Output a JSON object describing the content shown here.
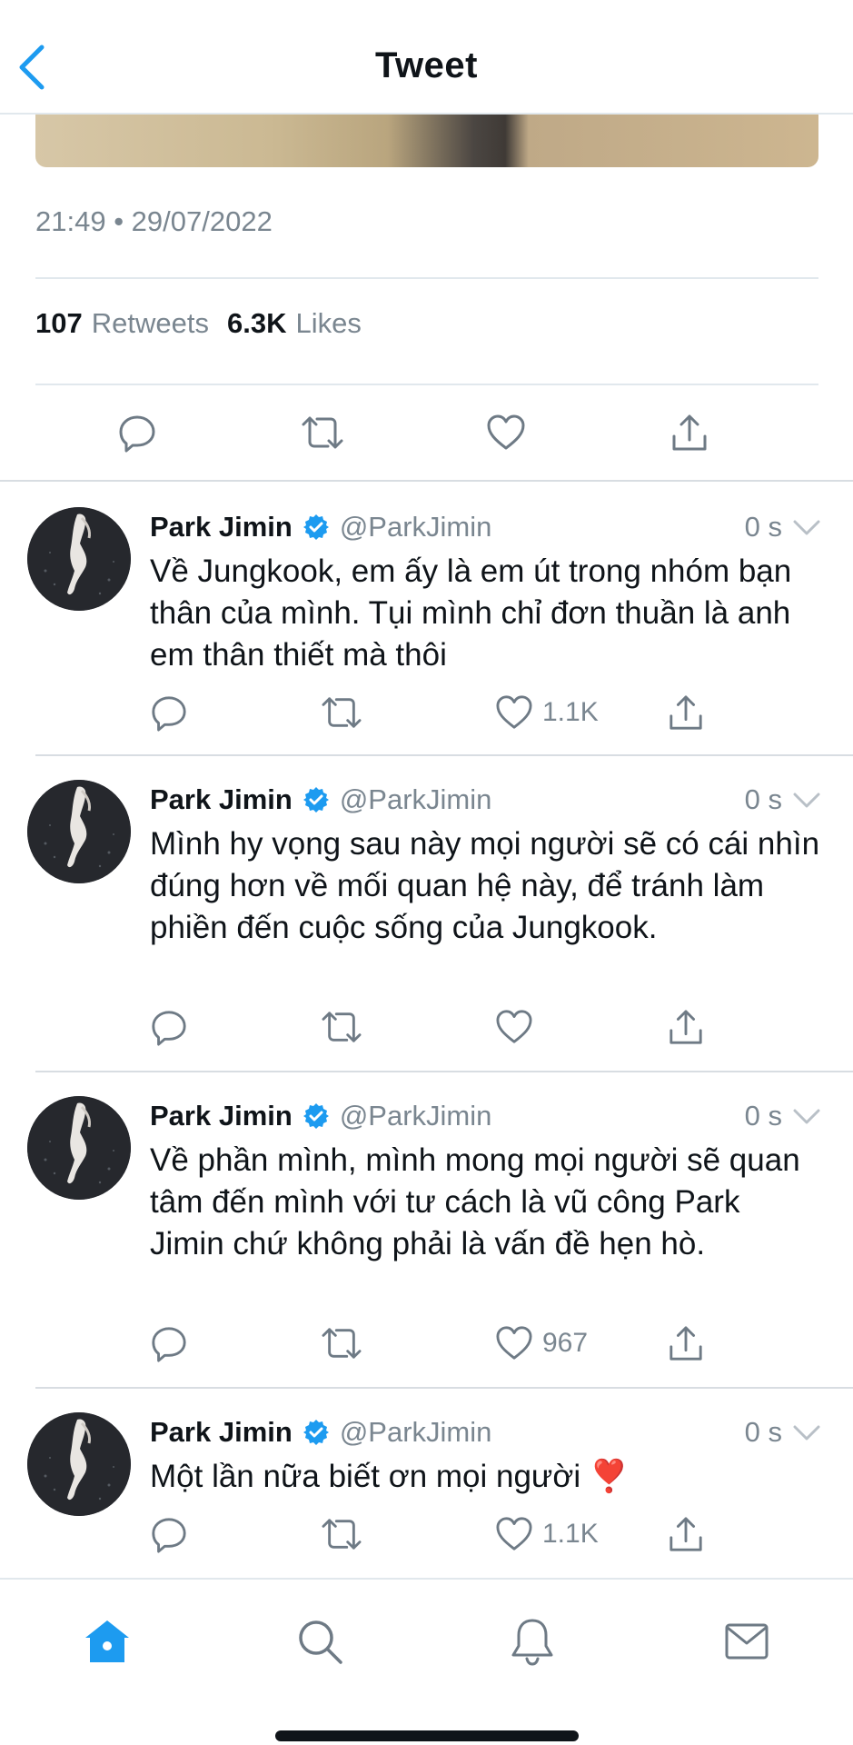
{
  "header": {
    "title": "Tweet",
    "back_icon": "chevron-left-icon"
  },
  "main_tweet": {
    "timestamp": "21:49 • 29/07/2022",
    "retweets_count": "107",
    "retweets_label": "Retweets",
    "likes_count": "6.3K",
    "likes_label": "Likes"
  },
  "replies": [
    {
      "name": "Park Jimin",
      "handle": "@ParkJimin",
      "time": "0 s",
      "text": "Về Jungkook, em ấy là em út trong nhóm bạn thân của mình. Tụi mình chỉ đơn thuần là anh em thân thiết mà thôi",
      "likes": "1.1K"
    },
    {
      "name": "Park Jimin",
      "handle": "@ParkJimin",
      "time": "0 s",
      "text": "Mình hy vọng sau này mọi người sẽ có cái nhìn đúng hơn về mối quan hệ này, để tránh làm phiền đến cuộc sống của Jungkook.",
      "likes": ""
    },
    {
      "name": "Park Jimin",
      "handle": "@ParkJimin",
      "time": "0 s",
      "text": "Về phần mình, mình mong mọi người sẽ quan tâm đến mình với tư cách là vũ công Park Jimin chứ không phải là vấn đề hẹn hò.",
      "likes": "967"
    },
    {
      "name": "Park Jimin",
      "handle": "@ParkJimin",
      "time": "0 s",
      "text": "Một lần nữa biết ơn mọi người ❣️",
      "likes": "1.1K"
    }
  ],
  "colors": {
    "accent": "#1d9bf0",
    "icon_gray": "#6e7a85",
    "text_gray": "#7a8690"
  },
  "tabs": [
    "home-icon",
    "search-icon",
    "notifications-icon",
    "messages-icon"
  ]
}
